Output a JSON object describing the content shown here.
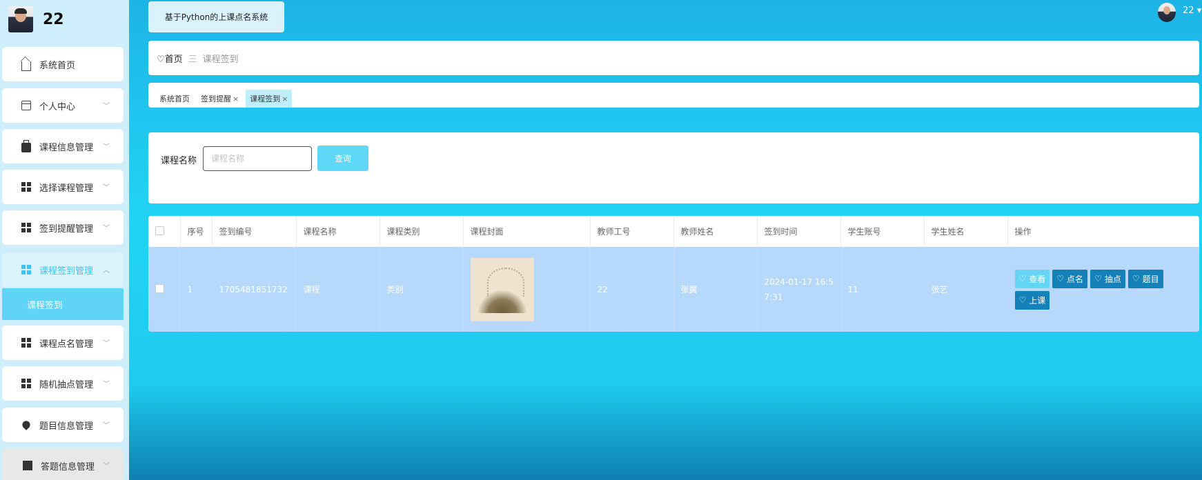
{
  "sidebar": {
    "username": "22",
    "menu": [
      {
        "label": "系统首页",
        "icon": "home-icon"
      },
      {
        "label": "个人中心",
        "icon": "card-icon"
      },
      {
        "label": "课程信息管理",
        "icon": "briefcase-icon"
      },
      {
        "label": "选择课程管理",
        "icon": "grid-icon"
      },
      {
        "label": "签到提醒管理",
        "icon": "grid-icon"
      },
      {
        "label": "课程签到管理",
        "icon": "grid-icon"
      },
      {
        "label": "课程点名管理",
        "icon": "grid-icon"
      },
      {
        "label": "随机抽点管理",
        "icon": "grid-icon"
      },
      {
        "label": "题目信息管理",
        "icon": "pin-icon"
      },
      {
        "label": "答题信息管理",
        "icon": "stand-icon"
      }
    ],
    "submenu_label": "课程签到"
  },
  "header": {
    "system_title": "基于Python的上课点名系统",
    "user": "22"
  },
  "breadcrumb": {
    "home": "♡首页",
    "separator": "三",
    "current": "课程签到"
  },
  "tabs": [
    {
      "label": "系统首页",
      "closable": false
    },
    {
      "label": "签到提醒",
      "closable": true
    },
    {
      "label": "课程签到",
      "closable": true
    }
  ],
  "search": {
    "label": "课程名称",
    "placeholder": "课程名称",
    "button": "查询"
  },
  "table": {
    "columns": [
      "序号",
      "签到编号",
      "课程名称",
      "课程类别",
      "课程封面",
      "教师工号",
      "教师姓名",
      "签到时间",
      "学生账号",
      "学生姓名",
      "操作"
    ],
    "rows": [
      {
        "index": "1",
        "sign_no": "1705481851732",
        "course_name": "课程",
        "course_type": "类别",
        "teacher_no": "22",
        "teacher_name": "张翼",
        "sign_time": "2024-01-17 16:57:31",
        "student_account": "11",
        "student_name": "张艺",
        "actions": [
          "查看",
          "点名",
          "抽点",
          "题目",
          "上课"
        ]
      }
    ]
  },
  "colors": {
    "accent": "#39c5f0",
    "action_button": "#1482b8",
    "row_selected": "#b6d8fb"
  }
}
